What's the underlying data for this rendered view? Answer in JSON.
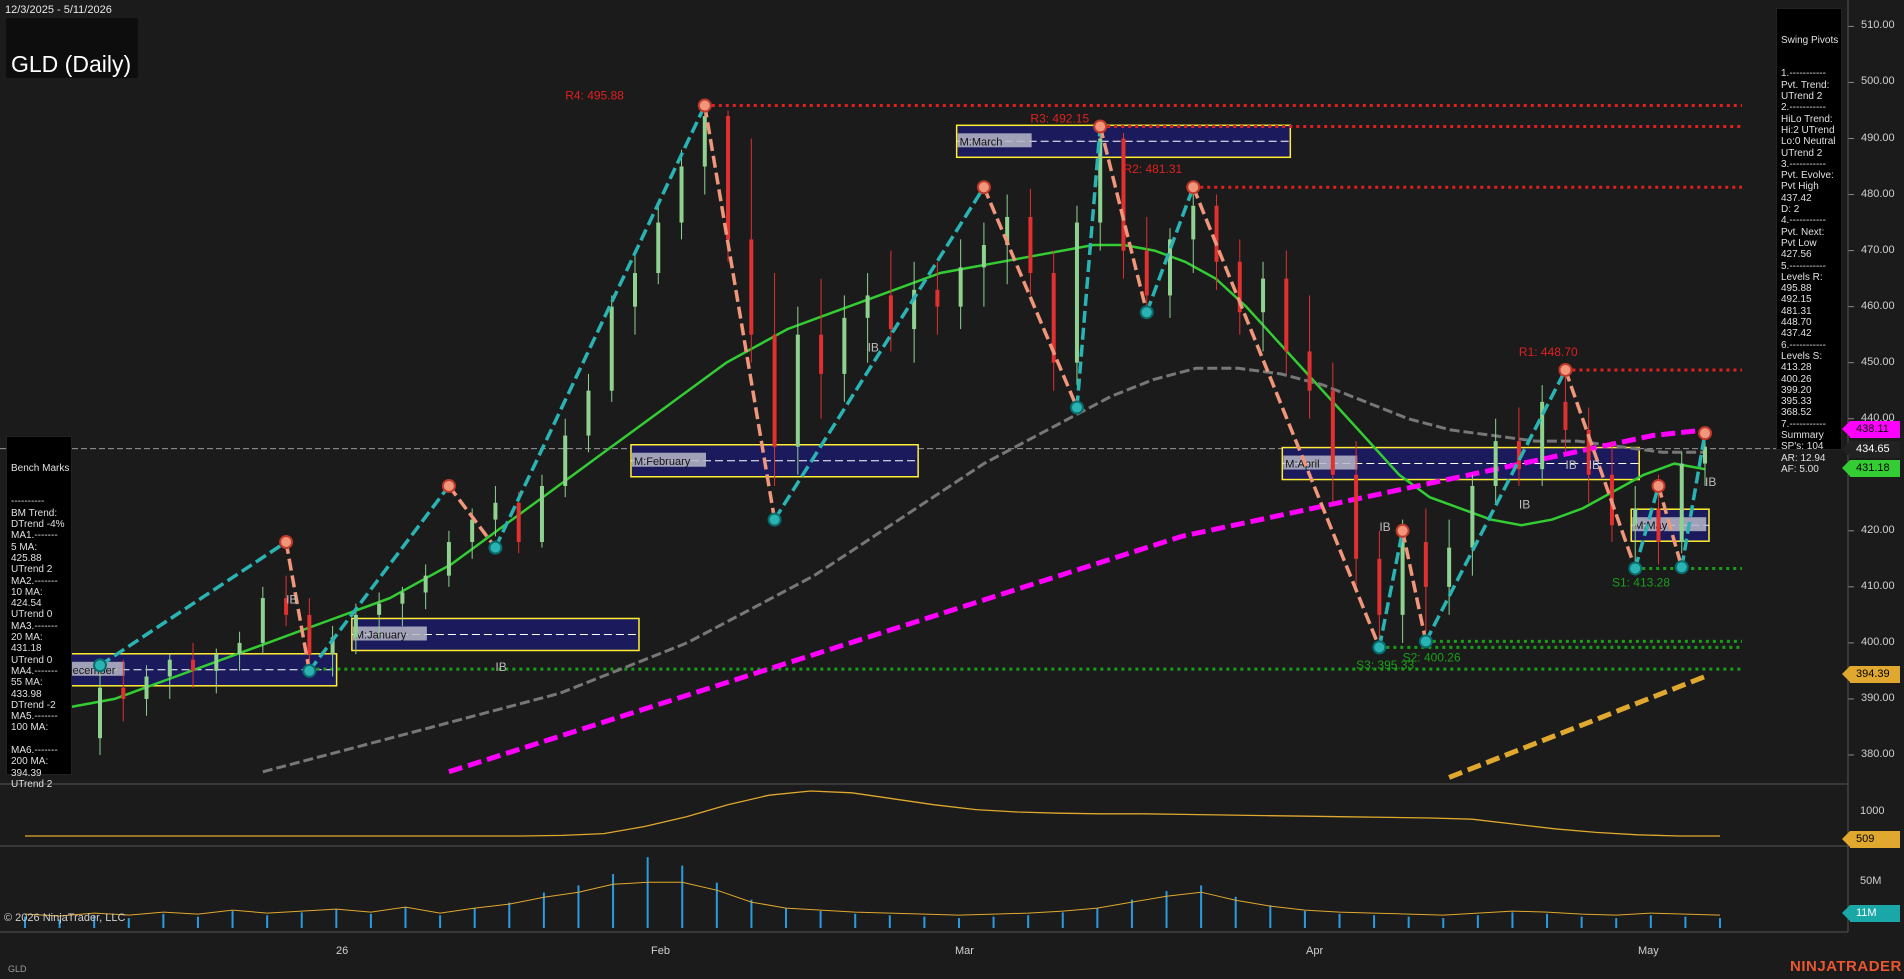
{
  "header": {
    "date_range": "12/3/2025 - 5/11/2026",
    "title": "GLD (Daily)"
  },
  "swing_pivots": {
    "title": "Swing Pivots",
    "lines": [
      "1.-----------",
      "Pvt. Trend:",
      "UTrend 2",
      "2.-----------",
      "HiLo Trend:",
      "Hi:2 UTrend",
      "Lo:0 Neutral",
      "UTrend 2",
      "3.-----------",
      "Pvt. Evolve:",
      "Pvt High",
      "437.42",
      "D: 2",
      "4.-----------",
      "Pvt. Next:",
      "Pvt Low",
      "427.56",
      "5.-----------",
      "Levels R:",
      "495.88",
      "492.15",
      "481.31",
      "448.70",
      "437.42",
      "6.-----------",
      "Levels S:",
      "413.28",
      "400.26",
      "399.20",
      "395.33",
      "368.52",
      "7.-----------",
      "Summary",
      "SP's: 104",
      "AR: 12.94",
      "AF: 5.00"
    ]
  },
  "bench_marks": {
    "title": "Bench Marks",
    "lines": [
      "----------",
      "BM Trend:",
      "DTrend -4%",
      "MA1.-------",
      "5 MA:",
      "425.88",
      "UTrend 2",
      "MA2.-------",
      "10 MA:",
      "424.54",
      "UTrend 0",
      "MA3.-------",
      "20 MA:",
      "431.18",
      "UTrend 0",
      "MA4.-------",
      "55 MA:",
      "433.98",
      "DTrend -2",
      "MA5.-------",
      "100 MA:",
      "",
      "MA6.-------",
      "200 MA:",
      "394.39",
      "UTrend 2"
    ]
  },
  "price_axis": {
    "ticks": [
      "510.00",
      "500.00",
      "490.00",
      "480.00",
      "470.00",
      "460.00",
      "450.00",
      "440.00",
      "430.00",
      "420.00",
      "410.00",
      "400.00",
      "390.00",
      "380.00"
    ]
  },
  "price_tags": [
    {
      "label": "438.11",
      "value": 438.11,
      "bg": "#ff00ff",
      "fg": "#000000"
    },
    {
      "label": "434.65",
      "value": 434.65,
      "bg": "#222222",
      "fg": "#ffffff"
    },
    {
      "label": "431.18",
      "value": 431.18,
      "bg": "#33cc33",
      "fg": "#000000"
    },
    {
      "label": "394.39",
      "value": 394.39,
      "bg": "#e0a82e",
      "fg": "#000000"
    }
  ],
  "indicator_axis": {
    "ticks": [
      "1000"
    ],
    "tag": "509"
  },
  "volume_axis": {
    "ticks": [
      "50M"
    ],
    "tag": "11M"
  },
  "x_axis": {
    "labels": [
      "26",
      "Feb",
      "Mar",
      "Apr",
      "May"
    ]
  },
  "annotations": {
    "resistance": [
      "R4: 495.88",
      "R3: 492.15",
      "R2: 481.31",
      "R1: 448.70"
    ],
    "support": [
      "S1: 413.28",
      "S2: 400.26",
      "S3: 395.33"
    ],
    "months": [
      "M:December",
      "M:January",
      "M:February",
      "M:March",
      "M:April",
      "M:May"
    ],
    "ib": "IB"
  },
  "footer": {
    "copyright": "© 2026 NinjaTrader, LLC",
    "brand": "NINJATRADER",
    "symbol": "GLD"
  },
  "colors": {
    "background": "#1b1b1b",
    "up_candle": "#8fd18f",
    "down_candle": "#e03030",
    "support": "#1a9e1a",
    "resistance": "#e02020",
    "pivot_up": "#2ab3b3",
    "pivot_down": "#f0967a",
    "ma_green": "#33cc33",
    "ma_gray": "#777777",
    "ma_magenta": "#ff00ff",
    "ma_orange": "#e0a82e",
    "month_box": "#1a1a5c",
    "month_border": "#ffee33"
  },
  "chart_data": {
    "type": "candlestick",
    "y_range": [
      375,
      514
    ],
    "candles_ohlc": [
      [
        383,
        396,
        380,
        392
      ],
      [
        392,
        397,
        386,
        390
      ],
      [
        390,
        396,
        387,
        394
      ],
      [
        394,
        398,
        390,
        397
      ],
      [
        397,
        400,
        392,
        395
      ],
      [
        395,
        399,
        391,
        398
      ],
      [
        398,
        402,
        395,
        400
      ],
      [
        400,
        410,
        398,
        408
      ],
      [
        408,
        412,
        403,
        405
      ],
      [
        405,
        408,
        395,
        398
      ],
      [
        398,
        403,
        394,
        401
      ],
      [
        401,
        407,
        398,
        405
      ],
      [
        405,
        409,
        401,
        407
      ],
      [
        407,
        410,
        403,
        409
      ],
      [
        409,
        414,
        406,
        412
      ],
      [
        412,
        420,
        410,
        418
      ],
      [
        418,
        424,
        415,
        422
      ],
      [
        422,
        428,
        419,
        425
      ],
      [
        425,
        427,
        416,
        418
      ],
      [
        418,
        430,
        417,
        428
      ],
      [
        428,
        440,
        426,
        437
      ],
      [
        437,
        448,
        434,
        445
      ],
      [
        445,
        462,
        443,
        460
      ],
      [
        460,
        470,
        455,
        466
      ],
      [
        466,
        478,
        464,
        475
      ],
      [
        475,
        488,
        472,
        485
      ],
      [
        485,
        496,
        480,
        494
      ],
      [
        494,
        495,
        468,
        472
      ],
      [
        472,
        490,
        450,
        455
      ],
      [
        455,
        466,
        428,
        435
      ],
      [
        435,
        460,
        430,
        455
      ],
      [
        455,
        465,
        440,
        448
      ],
      [
        448,
        462,
        443,
        458
      ],
      [
        458,
        466,
        450,
        462
      ],
      [
        462,
        470,
        452,
        456
      ],
      [
        456,
        468,
        450,
        463
      ],
      [
        463,
        468,
        455,
        460
      ],
      [
        460,
        472,
        456,
        467
      ],
      [
        467,
        475,
        460,
        471
      ],
      [
        471,
        480,
        464,
        476
      ],
      [
        476,
        481,
        462,
        466
      ],
      [
        466,
        470,
        445,
        450
      ],
      [
        450,
        478,
        446,
        475
      ],
      [
        475,
        492,
        470,
        490
      ],
      [
        490,
        491,
        465,
        470
      ],
      [
        470,
        476,
        458,
        462
      ],
      [
        462,
        474,
        458,
        472
      ],
      [
        472,
        481,
        466,
        478
      ],
      [
        478,
        480,
        463,
        468
      ],
      [
        468,
        472,
        455,
        459
      ],
      [
        459,
        468,
        452,
        465
      ],
      [
        465,
        470,
        448,
        452
      ],
      [
        452,
        462,
        440,
        445
      ],
      [
        445,
        450,
        425,
        430
      ],
      [
        430,
        436,
        410,
        415
      ],
      [
        415,
        420,
        399,
        405
      ],
      [
        405,
        422,
        400,
        418
      ],
      [
        418,
        424,
        402,
        410
      ],
      [
        410,
        422,
        405,
        417
      ],
      [
        417,
        430,
        412,
        428
      ],
      [
        428,
        440,
        425,
        436
      ],
      [
        436,
        442,
        428,
        431
      ],
      [
        431,
        446,
        428,
        443
      ],
      [
        443,
        449,
        434,
        438
      ],
      [
        438,
        442,
        425,
        430
      ],
      [
        430,
        436,
        418,
        421
      ],
      [
        421,
        428,
        413,
        424
      ],
      [
        424,
        430,
        414,
        418
      ],
      [
        418,
        434,
        416,
        432
      ],
      [
        432,
        437,
        428,
        435
      ]
    ],
    "swing_pivots": [
      {
        "date_index": 0,
        "price": 396
      },
      {
        "date_index": 8,
        "price": 418
      },
      {
        "date_index": 9,
        "price": 395
      },
      {
        "date_index": 15,
        "price": 428
      },
      {
        "date_index": 17,
        "price": 417
      },
      {
        "date_index": 26,
        "price": 495.88
      },
      {
        "date_index": 29,
        "price": 422
      },
      {
        "date_index": 38,
        "price": 481.31
      },
      {
        "date_index": 42,
        "price": 442
      },
      {
        "date_index": 43,
        "price": 492.15
      },
      {
        "date_index": 45,
        "price": 459
      },
      {
        "date_index": 47,
        "price": 481.31
      },
      {
        "date_index": 55,
        "price": 399.2
      },
      {
        "date_index": 56,
        "price": 420
      },
      {
        "date_index": 57,
        "price": 400.26
      },
      {
        "date_index": 63,
        "price": 448.7
      },
      {
        "date_index": 66,
        "price": 413.28
      },
      {
        "date_index": 67,
        "price": 428
      },
      {
        "date_index": 68,
        "price": 413.5
      },
      {
        "date_index": 69,
        "price": 437.42
      }
    ],
    "resistance_levels": [
      495.88,
      492.15,
      481.31,
      448.7,
      437.42
    ],
    "support_levels": [
      413.28,
      400.26,
      399.2,
      395.33
    ],
    "ma_20": [
      388,
      389,
      390,
      392,
      394,
      396,
      398,
      400,
      402,
      404,
      406,
      408,
      411,
      414,
      418,
      422,
      426,
      430,
      434,
      438,
      442,
      446,
      450,
      453,
      456,
      458,
      460,
      462,
      464,
      466,
      467,
      468,
      469,
      470,
      471,
      471,
      470,
      468,
      465,
      460,
      454,
      448,
      442,
      436,
      430,
      426,
      424,
      422,
      421,
      422,
      424,
      427,
      430,
      432,
      431
    ],
    "ma_55": [
      377,
      379,
      381,
      383,
      385,
      387,
      389,
      391,
      394,
      397,
      400,
      404,
      408,
      412,
      417,
      422,
      427,
      432,
      436,
      440,
      444,
      447,
      449,
      449,
      448,
      446,
      443,
      440,
      438,
      437,
      436,
      436,
      435,
      434,
      434
    ],
    "ma_100": [
      377,
      380,
      383,
      386,
      389,
      392,
      395,
      398,
      401,
      404,
      407,
      410,
      413,
      416,
      419,
      421,
      423,
      425,
      427,
      429,
      431,
      433,
      435,
      437,
      438
    ],
    "ma_200": [
      376,
      378,
      380,
      382,
      384,
      386,
      388,
      390,
      392,
      394
    ],
    "indicator": [
      100,
      100,
      100,
      100,
      100,
      100,
      100,
      100,
      100,
      100,
      100,
      100,
      100,
      110,
      140,
      260,
      420,
      620,
      780,
      850,
      820,
      720,
      620,
      540,
      500,
      480,
      470,
      470,
      460,
      450,
      440,
      430,
      420,
      410,
      400,
      380,
      300,
      220,
      160,
      120,
      100,
      100
    ],
    "volume": [
      8,
      6,
      9,
      7,
      10,
      8,
      12,
      9,
      11,
      13,
      10,
      15,
      9,
      14,
      18,
      25,
      30,
      38,
      50,
      44,
      32,
      20,
      14,
      12,
      10,
      9,
      8,
      7,
      8,
      9,
      11,
      14,
      20,
      26,
      30,
      22,
      16,
      12,
      10,
      9,
      8,
      7,
      9,
      11,
      10,
      8,
      7,
      9,
      8,
      7
    ]
  }
}
